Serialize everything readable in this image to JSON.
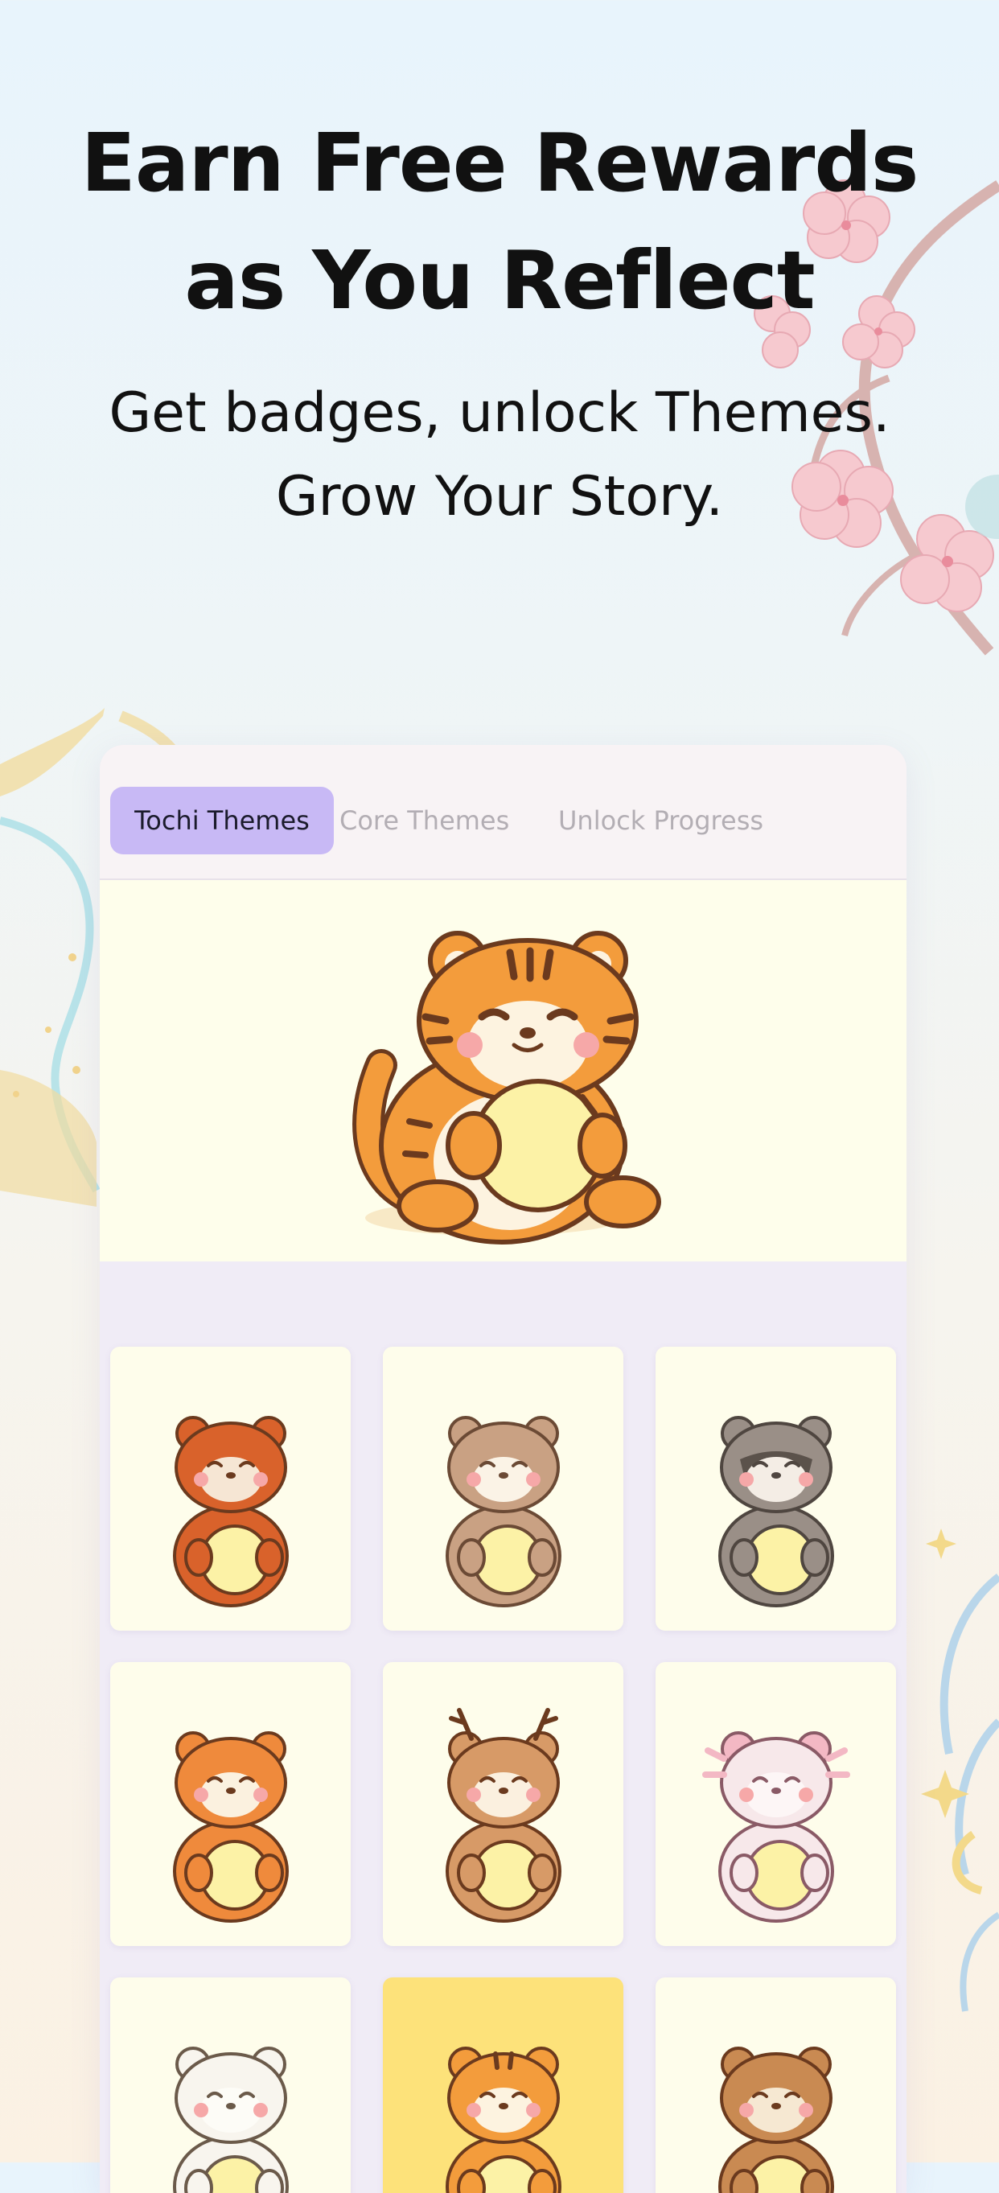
{
  "headline": [
    "Earn Free Rewards",
    "as You Reflect"
  ],
  "subheadline": [
    "Get badges, unlock Themes.",
    "Grow Your Story."
  ],
  "tabs": [
    {
      "label": "Tochi Themes",
      "active": true
    },
    {
      "label": "Core Themes",
      "active": false
    },
    {
      "label": "Unlock Progress",
      "active": false
    }
  ],
  "featured": {
    "character": "tiger",
    "icon": "tiger-mascot-icon"
  },
  "themes": [
    {
      "character": "red-panda",
      "icon": "red-panda-icon",
      "selected": false
    },
    {
      "character": "otter",
      "icon": "otter-icon",
      "selected": false
    },
    {
      "character": "raccoon",
      "icon": "raccoon-icon",
      "selected": false
    },
    {
      "character": "shiba-fox",
      "icon": "shiba-icon",
      "selected": false
    },
    {
      "character": "deer",
      "icon": "deer-icon",
      "selected": false
    },
    {
      "character": "axolotl",
      "icon": "axolotl-icon",
      "selected": false
    },
    {
      "character": "polar-bear",
      "icon": "polar-bear-icon",
      "selected": false
    },
    {
      "character": "tiger",
      "icon": "tiger-icon",
      "selected": true
    },
    {
      "character": "owl",
      "icon": "owl-icon",
      "selected": false
    }
  ],
  "colors": {
    "active_tab": "#c8b9f5",
    "selected_tile": "#fde27a",
    "tile_bg": "#fefdeb",
    "inactive_tab_text": "#b3aeb4"
  }
}
